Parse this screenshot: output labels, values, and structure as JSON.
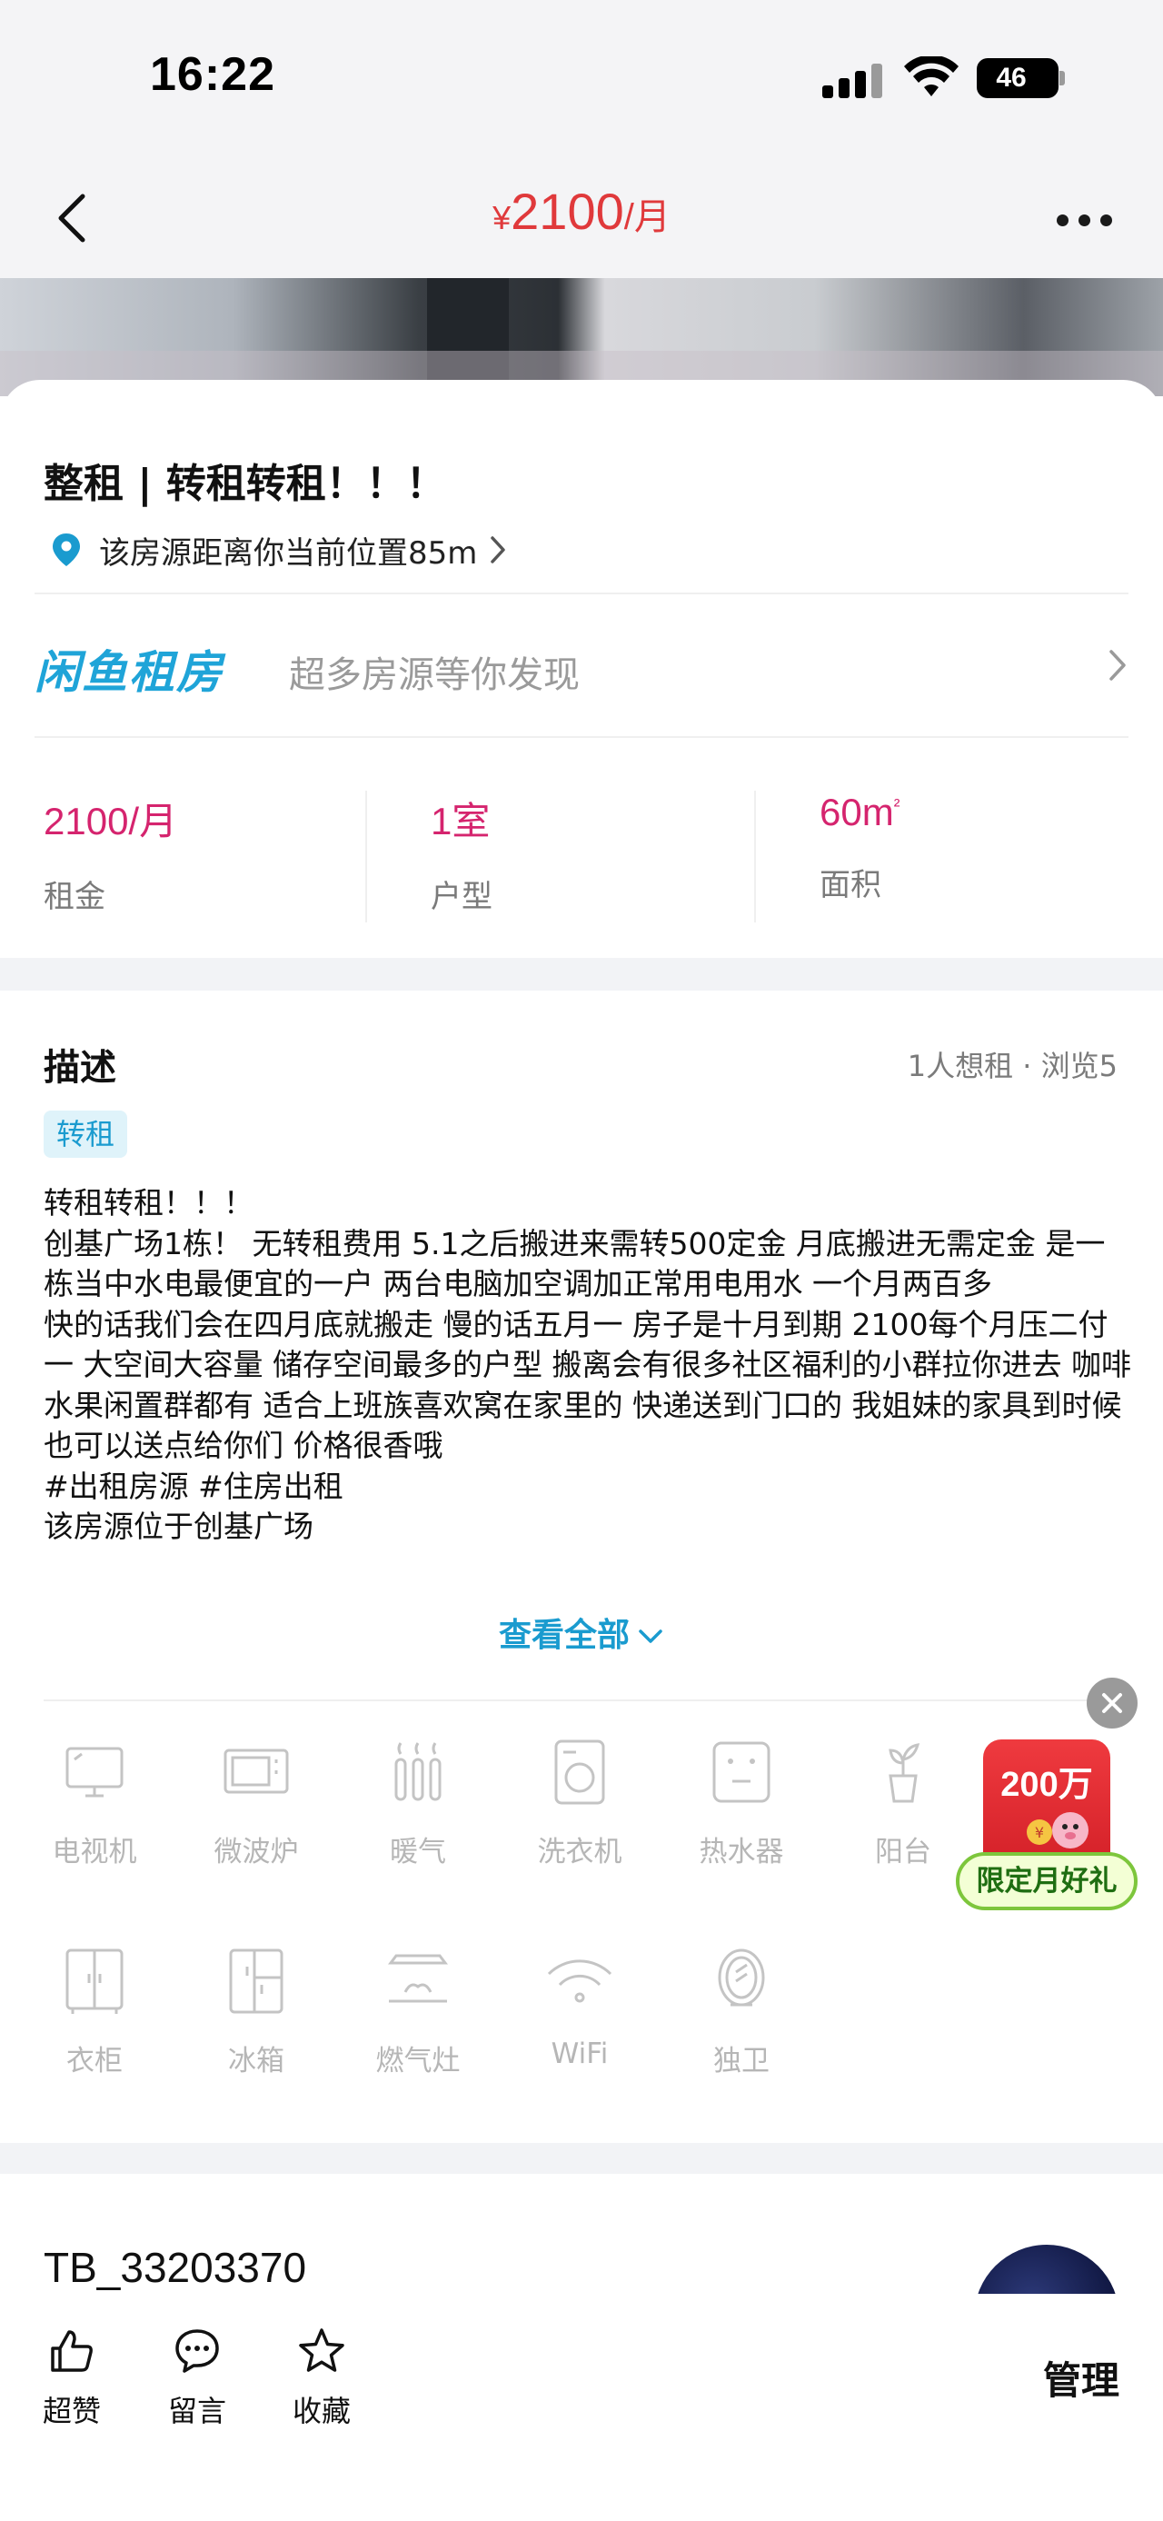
{
  "status_bar": {
    "time": "16:22",
    "battery": "46"
  },
  "nav": {
    "currency": "¥",
    "price": "2100",
    "unit": "/月"
  },
  "listing": {
    "title": "整租 | 转租转租！！！",
    "location": "该房源距离你当前位置85m"
  },
  "brand": {
    "logo": "闲鱼租房",
    "slogan": "超多房源等你发现"
  },
  "stats": [
    {
      "value": "2100/月",
      "label": "租金"
    },
    {
      "value": "1室",
      "label": "户型"
    },
    {
      "value": "60m",
      "value_sup": "²",
      "label": "面积"
    }
  ],
  "description": {
    "title": "描述",
    "meta": "1人想租 · 浏览5",
    "tag": "转租",
    "text": "转租转租！！！\n创基广场1栋！ 无转租费用 5.1之后搬进来需转500定金 月底搬进无需定金 是一栋当中水电最便宜的一户 两台电脑加空调加正常用电用水 一个月两百多\n快的话我们会在四月底就搬走 慢的话五月一 房子是十月到期 2100每个月压二付一 大空间大容量 储存空间最多的户型 搬离会有很多社区福利的小群拉你进去 咖啡水果闲置群都有 适合上班族喜欢窝在家里的 快递送到门口的 我姐妹的家具到时候也可以送点给你们 价格很香哦\n#出租房源 #住房出租\n该房源位于创基广场",
    "see_all": "查看全部"
  },
  "amenities": [
    {
      "icon": "tv-icon",
      "label": "电视机"
    },
    {
      "icon": "microwave-icon",
      "label": "微波炉"
    },
    {
      "icon": "heater-icon",
      "label": "暖气"
    },
    {
      "icon": "washer-icon",
      "label": "洗衣机"
    },
    {
      "icon": "water-heater-icon",
      "label": "热水器"
    },
    {
      "icon": "balcony-icon",
      "label": "阳台"
    },
    {
      "icon": "wardrobe-icon",
      "label": "衣柜"
    },
    {
      "icon": "fridge-icon",
      "label": "冰箱"
    },
    {
      "icon": "gas-stove-icon",
      "label": "燃气灶"
    },
    {
      "icon": "wifi-icon",
      "label": "WiFi"
    },
    {
      "icon": "bathroom-icon",
      "label": "独卫"
    }
  ],
  "promo": {
    "amount": "200万",
    "label": "限定月好礼"
  },
  "seller": {
    "name": "TB_33203370"
  },
  "bottom_bar": {
    "actions": [
      {
        "icon": "thumbs-up-icon",
        "label": "超赞"
      },
      {
        "icon": "comment-icon",
        "label": "留言"
      },
      {
        "icon": "star-icon",
        "label": "收藏"
      }
    ],
    "manage": "管理"
  },
  "colors": {
    "price_red": "#e0393b",
    "stat_pink": "#d5246e",
    "accent_blue": "#1a9bcf",
    "promo_green": "#7dc63c"
  }
}
